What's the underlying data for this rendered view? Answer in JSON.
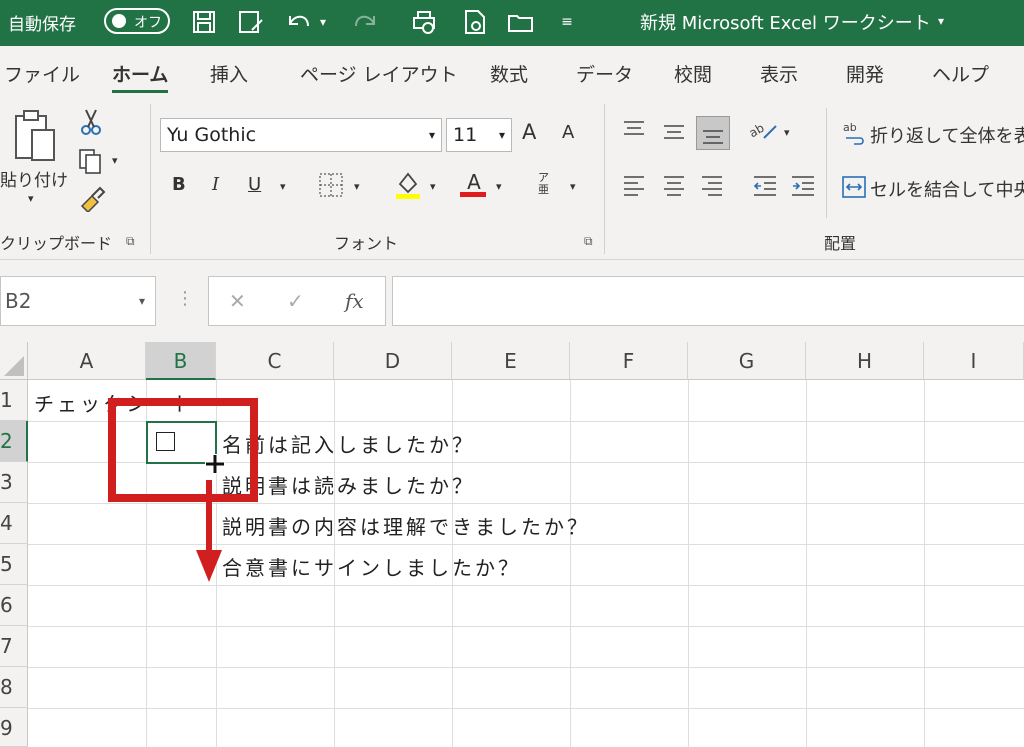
{
  "titlebar": {
    "autosave_label": "自動保存",
    "autosave_state": "オフ",
    "doc_title": "新規 Microsoft Excel ワークシート",
    "bg_color": "#217346"
  },
  "tabs": [
    "ファイル",
    "ホーム",
    "挿入",
    "ページ レイアウト",
    "数式",
    "データ",
    "校閲",
    "表示",
    "開発",
    "ヘルプ"
  ],
  "active_tab": "ホーム",
  "ribbon": {
    "clipboard": {
      "paste_label": "貼り付け",
      "group_label": "クリップボード"
    },
    "font": {
      "font_name": "Yu Gothic",
      "font_size": "11",
      "bold": "B",
      "italic": "I",
      "underline": "U",
      "font_color_letter": "A",
      "grow_letter": "A",
      "shrink_letter": "A",
      "phonetic_letter": "ア亜",
      "group_label": "フォント"
    },
    "alignment": {
      "wrap_text": "折り返して全体を表",
      "merge_center": "セルを結合して中央",
      "group_label": "配置"
    }
  },
  "formula_bar": {
    "name_box": "B2",
    "cancel": "✕",
    "enter": "✓",
    "fx": "fx",
    "content": ""
  },
  "grid": {
    "columns": [
      "A",
      "B",
      "C",
      "D",
      "E",
      "F",
      "G",
      "H",
      "I"
    ],
    "rows": [
      "1",
      "2",
      "3",
      "4",
      "5",
      "6",
      "7",
      "8",
      "9"
    ],
    "selected_cell": "B2",
    "cells": {
      "A1": "チェックシート",
      "C2": "名前は記入しましたか？",
      "C3": "説明書は読みましたか？",
      "C4": "説明書の内容は理解できましたか？",
      "C5": "合意書にサインしましたか？"
    }
  },
  "annotation": {
    "color": "#d11f1f"
  }
}
